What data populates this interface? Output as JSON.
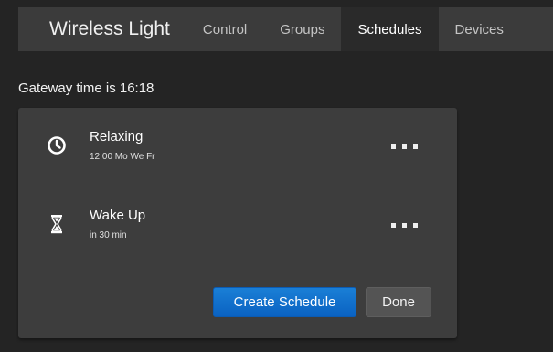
{
  "navbar": {
    "brand": "Wireless Light",
    "tabs": [
      {
        "label": "Control"
      },
      {
        "label": "Groups"
      },
      {
        "label": "Schedules",
        "active": true
      },
      {
        "label": "Devices"
      }
    ]
  },
  "gateway": {
    "time_text": "Gateway time is 16:18"
  },
  "schedules": [
    {
      "name": "Relaxing",
      "detail": "12:00  Mo We Fr",
      "icon": "clock-icon"
    },
    {
      "name": "Wake Up",
      "detail": "in 30 min",
      "icon": "hourglass-icon"
    }
  ],
  "actions": {
    "create_label": "Create Schedule",
    "done_label": "Done"
  },
  "colors": {
    "background": "#242424",
    "navbar": "#3b3b3b",
    "panel": "#3d3d3d",
    "primary": "#0a62c2"
  }
}
